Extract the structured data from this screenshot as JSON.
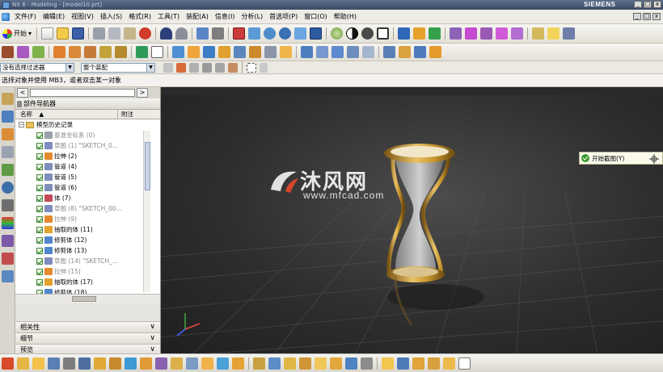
{
  "window": {
    "title": "NX 6 - Modeling - [model10.prt]",
    "brand": "SIEMENS",
    "minimize_glyph": "_",
    "restore_glyph": "□",
    "close_glyph": "x"
  },
  "menu": {
    "items": [
      "文件(F)",
      "编辑(E)",
      "视图(V)",
      "插入(S)",
      "格式(R)",
      "工具(T)",
      "装配(A)",
      "信息(I)",
      "分析(L)",
      "首选项(P)",
      "窗口(O)",
      "帮助(H)"
    ]
  },
  "toolbar": {
    "start_label": "开始",
    "start_arrow": "▾"
  },
  "filters": {
    "type_filter": "没有选择过滤器",
    "scope": "整个装配",
    "arrow": "▼"
  },
  "cue_line": "选择对象并使用 MB3，或者双击某一对象",
  "navigator": {
    "title": "部件导航器",
    "tab_prev": "<",
    "tab_next": ">",
    "col_name": "名称",
    "sort_arrow": "▲",
    "col_note": "附注",
    "root_expand": "−",
    "root_label": "模型历史记录",
    "items": [
      {
        "label": "基准坐标系 (0)",
        "dim": true
      },
      {
        "label": "草图 (1) \"SKETCH_0...",
        "dim": true
      },
      {
        "label": "拉伸 (2)",
        "dim": false
      },
      {
        "label": "管道 (4)",
        "dim": false
      },
      {
        "label": "管道 (5)",
        "dim": false
      },
      {
        "label": "管道 (6)",
        "dim": false
      },
      {
        "label": "体 (7)",
        "dim": false
      },
      {
        "label": "草图 (8) \"SKETCH_00...",
        "dim": true
      },
      {
        "label": "拉伸 (9)",
        "dim": true
      },
      {
        "label": "抽取的体 (11)",
        "dim": false
      },
      {
        "label": "修剪体 (12)",
        "dim": false
      },
      {
        "label": "修剪体 (13)",
        "dim": false
      },
      {
        "label": "草图 (14) \"SKETCH_...",
        "dim": true
      },
      {
        "label": "拉伸 (15)",
        "dim": true
      },
      {
        "label": "抽取的体 (17)",
        "dim": false
      },
      {
        "label": "修剪体 (18)",
        "dim": false
      }
    ],
    "sections": [
      {
        "label": "相关性",
        "chevron": "∨"
      },
      {
        "label": "细节",
        "chevron": "∨"
      },
      {
        "label": "预览",
        "chevron": "∨"
      }
    ]
  },
  "viewport": {
    "command_label": "开始截图(Y)"
  },
  "watermark": {
    "cn": "沐风网",
    "url": "www.mfcad.com"
  },
  "colors": {
    "viewport_bg": "#2e2e2e",
    "gold": "#c8962e",
    "grid": "#5a5a5a"
  }
}
